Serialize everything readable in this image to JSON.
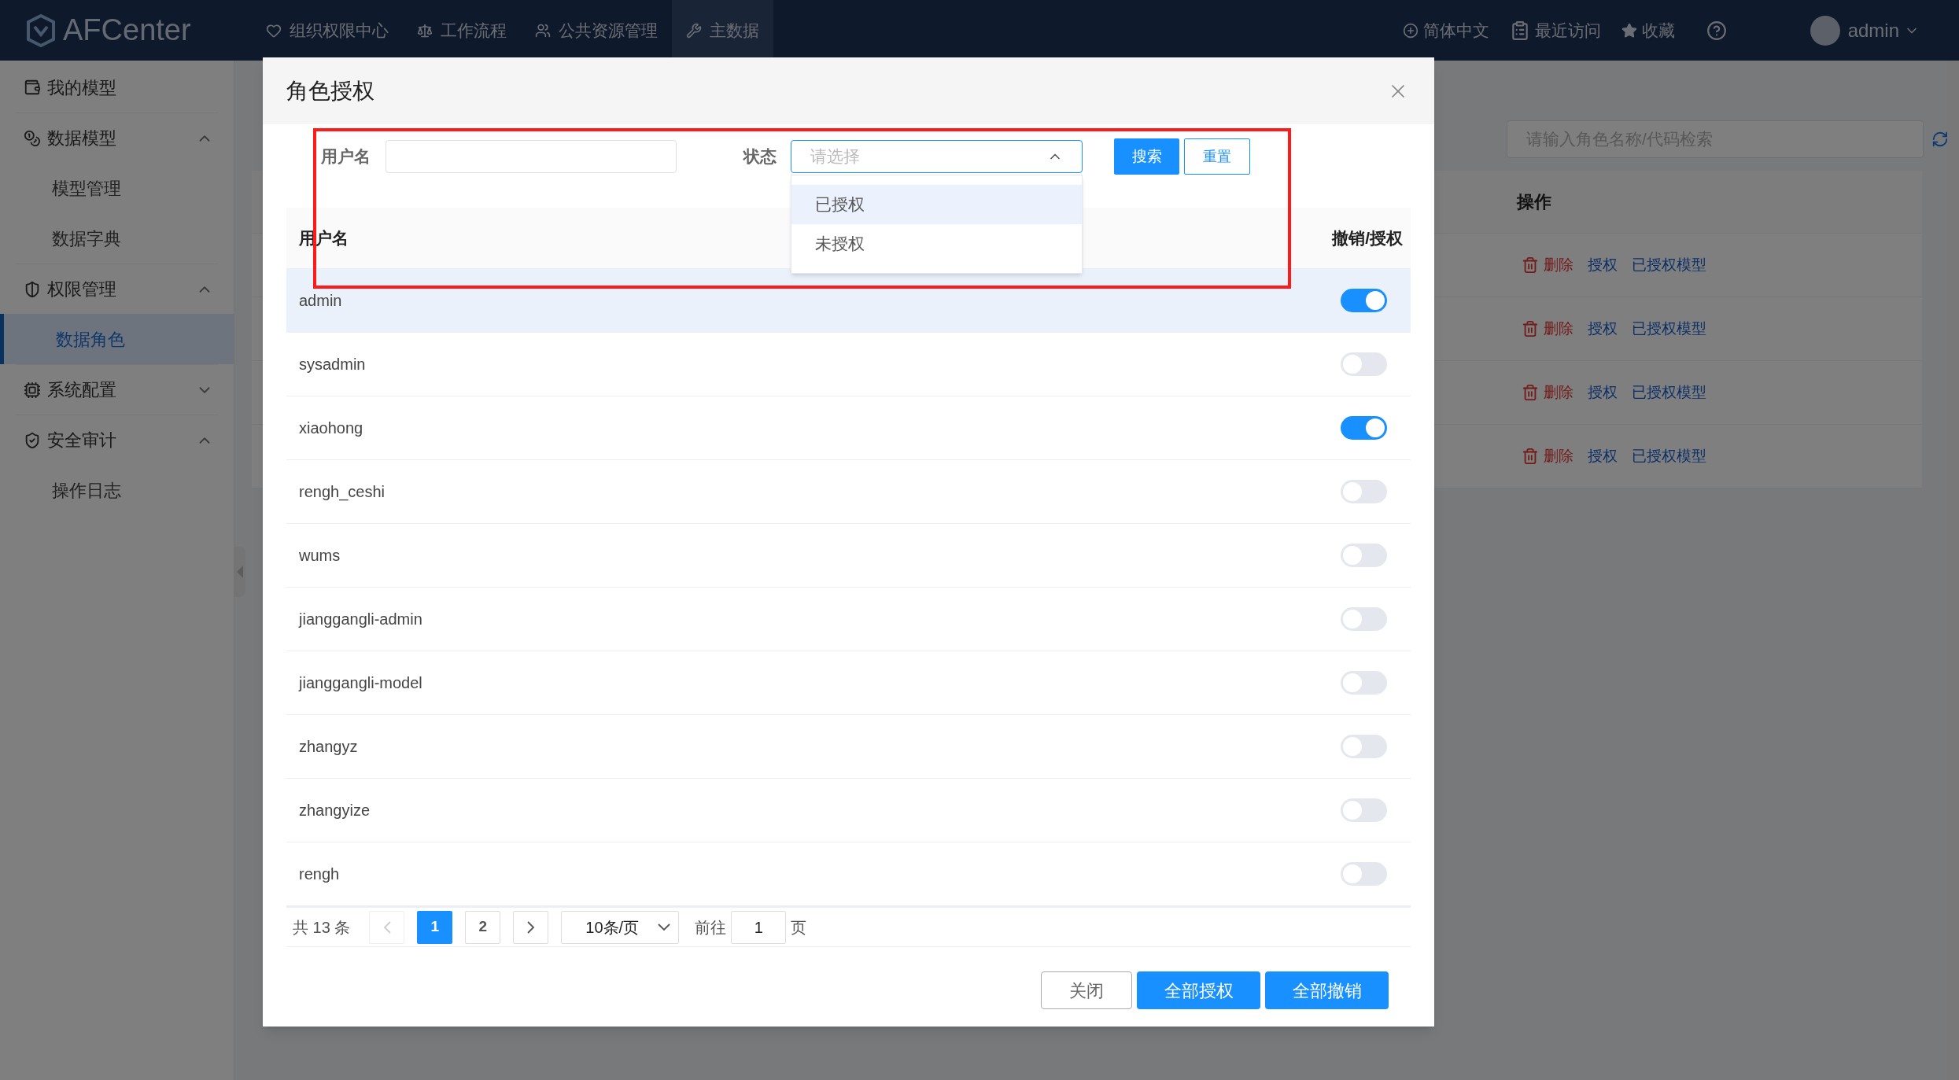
{
  "topbar": {
    "logo": "AFCenter",
    "nav": [
      {
        "label": "组织权限中心",
        "selected": false
      },
      {
        "label": "工作流程",
        "selected": false
      },
      {
        "label": "公共资源管理",
        "selected": false
      },
      {
        "label": "主数据",
        "selected": true
      }
    ],
    "language": "简体中文",
    "recent": "最近访问",
    "favorites": "收藏",
    "user": "admin"
  },
  "sidebar": {
    "items": [
      {
        "label": "我的模型",
        "kind": "link"
      },
      {
        "label": "数据模型",
        "kind": "group",
        "expanded": true,
        "children": [
          {
            "label": "模型管理",
            "selected": false
          },
          {
            "label": "数据字典",
            "selected": false
          }
        ]
      },
      {
        "label": "权限管理",
        "kind": "group",
        "expanded": true,
        "children": [
          {
            "label": "数据角色",
            "selected": true
          }
        ]
      },
      {
        "label": "系统配置",
        "kind": "group",
        "expanded": false
      },
      {
        "label": "安全审计",
        "kind": "group",
        "expanded": true,
        "children": [
          {
            "label": "操作日志",
            "selected": false
          }
        ]
      }
    ]
  },
  "background": {
    "search": {
      "placeholder": "请输入角色名称/代码检索"
    },
    "column": "操作",
    "rows": [
      {
        "delete": "删除",
        "grant": "授权",
        "models": "已授权模型"
      },
      {
        "delete": "删除",
        "grant": "授权",
        "models": "已授权模型"
      },
      {
        "delete": "删除",
        "grant": "授权",
        "models": "已授权模型"
      },
      {
        "delete": "删除",
        "grant": "授权",
        "models": "已授权模型"
      }
    ]
  },
  "dialog": {
    "title": "角色授权",
    "filters": {
      "username_label": "用户名",
      "status_label": "状态",
      "status_placeholder": "请选择",
      "open": true,
      "options": [
        {
          "label": "已授权",
          "selected": true
        },
        {
          "label": "未授权",
          "selected": false
        }
      ],
      "search_button": "搜索",
      "reset_button": "重置"
    },
    "table": {
      "columns": [
        "用户名",
        "撤销/授权"
      ],
      "rows": [
        {
          "name": "admin",
          "on": true,
          "highlighted": true
        },
        {
          "name": "sysadmin",
          "on": false,
          "highlighted": false
        },
        {
          "name": "xiaohong",
          "on": true,
          "highlighted": false
        },
        {
          "name": "rengh_ceshi",
          "on": false,
          "highlighted": false
        },
        {
          "name": "wums",
          "on": false,
          "highlighted": false
        },
        {
          "name": "jianggangli-admin",
          "on": false,
          "highlighted": false
        },
        {
          "name": "jianggangli-model",
          "on": false,
          "highlighted": false
        },
        {
          "name": "zhangyz",
          "on": false,
          "highlighted": false
        },
        {
          "name": "zhangyize",
          "on": false,
          "highlighted": false
        },
        {
          "name": "rengh",
          "on": false,
          "highlighted": false
        }
      ]
    },
    "pagination": {
      "total": "共 13 条",
      "pages": [
        {
          "label": "1",
          "selected": true
        },
        {
          "label": "2",
          "selected": false
        }
      ],
      "page_size": "10条/页",
      "goto_label": "前往",
      "goto_value": "1",
      "page_unit": "页"
    },
    "buttons": [
      {
        "label": "关闭",
        "kind": "default"
      },
      {
        "label": "全部授权",
        "kind": "primary"
      },
      {
        "label": "全部撤销",
        "kind": "primary"
      }
    ]
  }
}
